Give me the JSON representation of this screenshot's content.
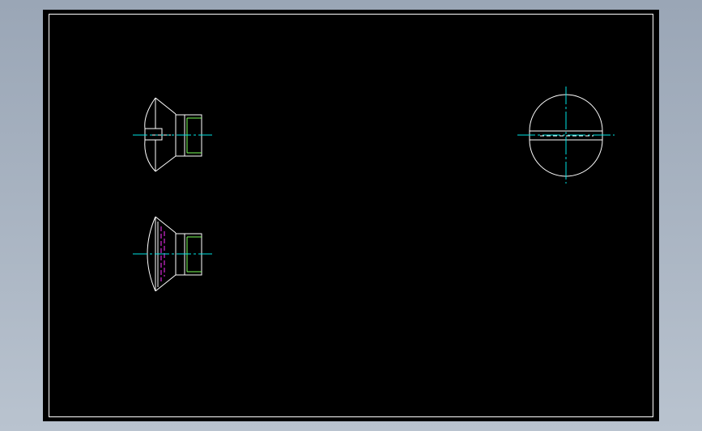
{
  "colors": {
    "background": "#9aa6b6",
    "canvas": "#000000",
    "geometry": "#ffffff",
    "centerline": "#00e5e5",
    "thread": "#7cff5a",
    "hidden": "#ff30ff"
  },
  "views": [
    {
      "name": "side-view-slotted",
      "icon": "countersunk-screw-side-slotted"
    },
    {
      "name": "side-view-hidden",
      "icon": "countersunk-screw-side"
    },
    {
      "name": "top-view",
      "icon": "screw-head-top-view"
    }
  ]
}
